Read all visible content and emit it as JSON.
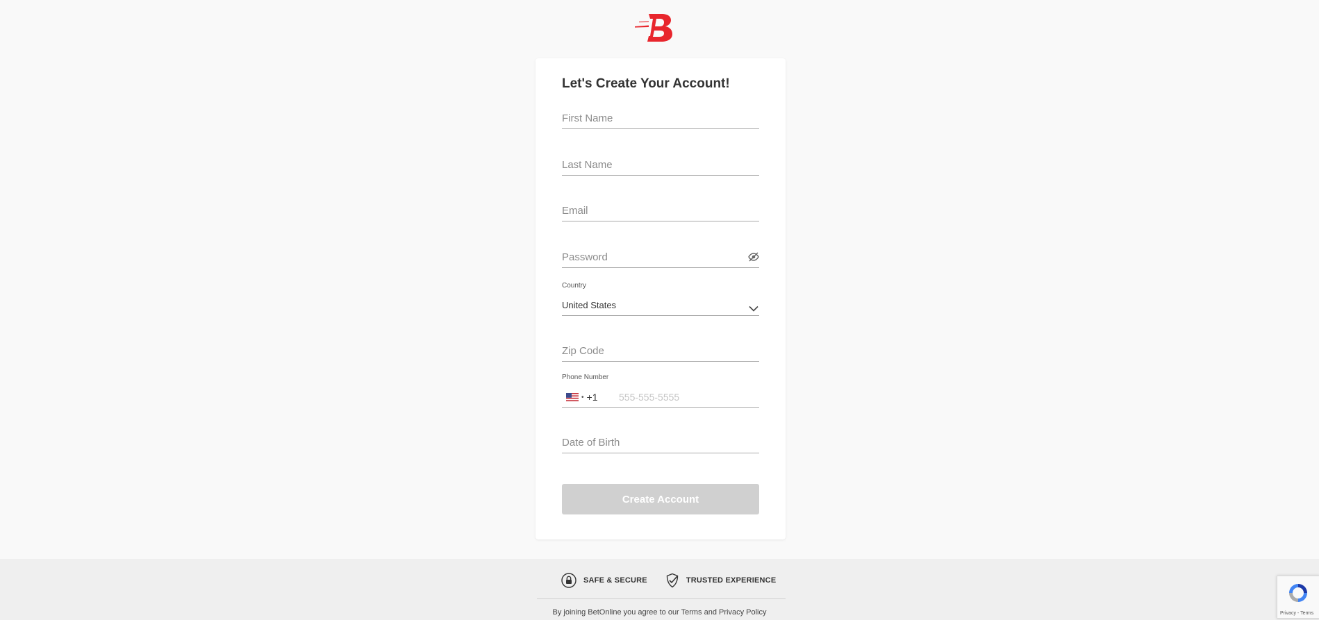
{
  "brand": {
    "logo_icon": "betonline-b-logo",
    "accent_color": "#e8262d"
  },
  "form": {
    "title": "Let's Create Your Account!",
    "first_name": {
      "placeholder": "First Name"
    },
    "last_name": {
      "placeholder": "Last Name"
    },
    "email": {
      "placeholder": "Email"
    },
    "password": {
      "placeholder": "Password",
      "toggle_icon": "eye-slash-icon"
    },
    "country": {
      "label": "Country",
      "value": "United States",
      "icon": "chevron-down-icon"
    },
    "zip": {
      "placeholder": "Zip Code"
    },
    "phone": {
      "label": "Phone Number",
      "flag_icon": "us-flag-icon",
      "dial_code": "+1",
      "placeholder": "555-555-5555"
    },
    "dob": {
      "placeholder": "Date of Birth"
    },
    "submit_label": "Create Account",
    "submit_color": "#d0d0d0"
  },
  "footer": {
    "badges": [
      {
        "icon": "lock-icon",
        "label": "SAFE & SECURE"
      },
      {
        "icon": "shield-check-icon",
        "label": "TRUSTED EXPERIENCE"
      }
    ],
    "agree_prefix": "By joining BetOnline you agree to our ",
    "terms_link": "Terms",
    "and_text": " and ",
    "privacy_link": "Privacy Policy"
  },
  "recaptcha": {
    "icon": "recaptcha-icon",
    "privacy": "Privacy",
    "separator": " - ",
    "terms": "Terms"
  }
}
